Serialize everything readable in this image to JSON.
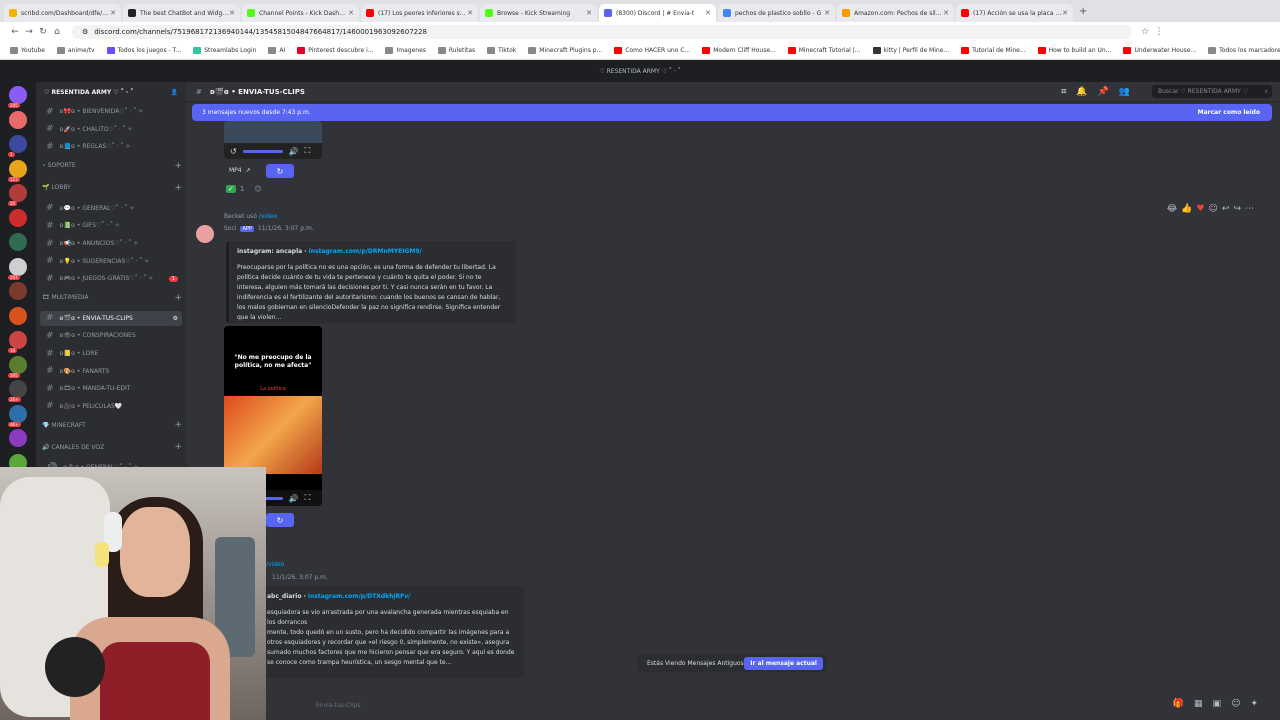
{
  "browser": {
    "tabs": [
      {
        "title": "scribd.com/Dashboard/dfe/actio",
        "color": "#f4b400",
        "active": false
      },
      {
        "title": "The best ChatBot and Widgets",
        "color": "#202124",
        "active": false
      },
      {
        "title": "Channel Points - Kick Dashboa",
        "color": "#53fc18",
        "active": false
      },
      {
        "title": "(17) Los peores inferiores sobre",
        "color": "#ff0000",
        "active": false
      },
      {
        "title": "Browse - Kick Streaming",
        "color": "#53fc18",
        "active": false
      },
      {
        "title": "(8300) Discord | # Envia-t",
        "color": "#5865f2",
        "active": true
      },
      {
        "title": "pechos de plastico sobllo - G",
        "color": "#4285f4",
        "active": false
      },
      {
        "title": "Amazon.com: Pechos de silico",
        "color": "#ff9900",
        "active": false
      },
      {
        "title": "(17) Acción se usa la placa de",
        "color": "#ff0000",
        "active": false
      }
    ],
    "url": "discord.com/channels/751968172136940144/1354581504847664817/1460001963092607228",
    "bookmarks": [
      {
        "label": "Youtube",
        "color": "#888"
      },
      {
        "label": "anime/tv",
        "color": "#888"
      },
      {
        "label": "Todos los juegos - T...",
        "color": "#6d4cff"
      },
      {
        "label": "Streamlabs Login",
        "color": "#31c3a2"
      },
      {
        "label": "AI",
        "color": "#888"
      },
      {
        "label": "Pinterest descubre i...",
        "color": "#e60023"
      },
      {
        "label": "Imagenes",
        "color": "#888"
      },
      {
        "label": "Ruletitas",
        "color": "#888"
      },
      {
        "label": "Tiktok",
        "color": "#888"
      },
      {
        "label": "Minecraft Plugins p...",
        "color": "#888"
      },
      {
        "label": "Como HACER uno C...",
        "color": "#ff0000"
      },
      {
        "label": "Modern Cliff House...",
        "color": "#ff0000"
      },
      {
        "label": "Minecraft Tutorial |...",
        "color": "#ff0000"
      },
      {
        "label": "kitty | Perfil de Mine...",
        "color": "#333"
      },
      {
        "label": "Tutorial de Mine...",
        "color": "#ff0000"
      },
      {
        "label": "How to build an Un...",
        "color": "#ff0000"
      },
      {
        "label": "Underwater House...",
        "color": "#ff0000"
      },
      {
        "label": "Todos los marcadores",
        "color": "#888"
      }
    ]
  },
  "discord": {
    "window_title": "♡ RESENTIDA ARMY ♡ ˚ · ˚",
    "server_name": "♡ RESENTIDA ARMY ♡ ˚ · ˚",
    "servers": [
      {
        "badge": "205",
        "color": "#8a5cf6"
      },
      {
        "badge": "",
        "color": "#e86a6a"
      },
      {
        "badge": "1",
        "color": "#3b4a9e"
      },
      {
        "badge": "123",
        "color": "#e8a41c"
      },
      {
        "badge": "20",
        "color": "#b23b3b"
      },
      {
        "badge": "",
        "color": "#cf2d2d"
      },
      {
        "badge": "",
        "color": "#2e6b4f"
      },
      {
        "badge": "247",
        "color": "#cfcfcf"
      },
      {
        "badge": "",
        "color": "#7a3b2e"
      },
      {
        "badge": "",
        "color": "#d9541c"
      },
      {
        "badge": "14",
        "color": "#c44"
      },
      {
        "badge": "395",
        "color": "#5b7d2e"
      },
      {
        "badge": "2K+",
        "color": "#444"
      },
      {
        "badge": "4K+",
        "color": "#2d6fa8"
      },
      {
        "badge": "",
        "color": "#8b3bbf"
      },
      {
        "badge": "609",
        "color": "#5aa83b"
      }
    ],
    "channel_list": [
      {
        "type": "channel",
        "label": "ʚ🎀ɞ • BIENVENIDA♡˚ · ˚ ✧",
        "selected": false
      },
      {
        "type": "channel",
        "label": "ʚ🚀ɞ • CHALITO♡˚ · ˚ ✧",
        "selected": false
      },
      {
        "type": "channel",
        "label": "ʚ📘ɞ • REGLAS♡˚ · ˚ ✧",
        "selected": false
      },
      {
        "type": "category",
        "label": "⋆ SOPORTE"
      },
      {
        "type": "category",
        "label": "🌱 LOBBY"
      },
      {
        "type": "channel",
        "label": "ʚ💬ɞ • GENERAL♡˚ · ˚ ✧",
        "selected": false
      },
      {
        "type": "channel",
        "label": "ʚ📗ɞ • GIFS♡˚ · ˚ ✧",
        "selected": false
      },
      {
        "type": "channel",
        "label": "ʚ📢ɞ • ANUNCIOS♡˚ · ˚ ✧",
        "selected": false
      },
      {
        "type": "channel",
        "label": "ʚ💡ɞ • SUGERENCIAS♡˚ · ˚ ✧",
        "selected": false
      },
      {
        "type": "channel",
        "label": "ʚ🎮ɞ • JUEGOS-GRATIS♡˚ · ˚ ✧",
        "selected": false,
        "badge": "1"
      },
      {
        "type": "category",
        "label": "🎞 MULTIMEDIA"
      },
      {
        "type": "channel",
        "label": "ʚ🎬ɞ • ENVIA-TUS-CLIPS",
        "selected": true
      },
      {
        "type": "channel",
        "label": "ʚ👁ɞ • CONSPIRACIONES",
        "selected": false
      },
      {
        "type": "channel",
        "label": "ʚ📒ɞ • LORE",
        "selected": false
      },
      {
        "type": "channel",
        "label": "ʚ🎨ɞ • FANARTS",
        "selected": false
      },
      {
        "type": "channel",
        "label": "ʚ🎞ɞ • MANDA-TU-EDIT",
        "selected": false
      },
      {
        "type": "channel",
        "label": "ʚ🎥ɞ • PELICULAS🤍",
        "selected": false
      },
      {
        "type": "category",
        "label": "💎 MINECRAFT"
      },
      {
        "type": "category",
        "label": "🔊 CANALES DE VOZ"
      },
      {
        "type": "voice",
        "label": "ʚ🎙ɞ • GENERAL♡˚ · ˚ ✧",
        "selected": false
      }
    ],
    "channel_title": "ʚ🎬ɞ • ENVIA-TUS-CLIPS",
    "search_placeholder": "Buscar ♡ RESENTIDA ARMY ♡",
    "new_messages": "3 mensajes nuevos desde 7:43 p.m.",
    "mark_read": "Marcar como leído",
    "msg1": {
      "mp4": "MP4",
      "reaction_count": "1"
    },
    "msg2": {
      "reply": "Becket usó",
      "reply_cmd": "/video",
      "author": "Soci",
      "app_tag": "APP",
      "time": "11/1/26, 3:07 p.m.",
      "embed_source": "instagram",
      "embed_user": "ancapla",
      "embed_link": "instagram.com/p/DRMnMYEIGM9/",
      "embed_text": "Preocuparse por la política no es una opción, es una forma de defender tu libertad. La política decide cuánto de tu vida te pertenece y cuánto te quita el poder. Si no te interesa, alguien más tomará las decisiones por ti. Y casi nunca serán en tu favor. La indiferencia es el fertilizante del autoritarismo: cuando los buenos se cansan de hablar, los malos gobiernan en silencioDefender la paz no significa rendirse. Significa entender que la violen...",
      "video_caption": "\"No me preocupo de la política, no me afecta\"",
      "video_sub": "La política"
    },
    "msg3": {
      "reply_cmd": "/video",
      "time": "11/1/26, 3:07 p.m.",
      "embed_user": "abc_diario",
      "embed_link": "instagram.com/p/DTXdkhjRFv/",
      "embed_text": "esquiadora se vio arrastrada por una avalancha generada mientras esquiaba en los dorrancos\nmente, todo quedó en un susto, pero ha decidido compartir las imágenes para a otros esquiadores y recordar que «el riesgo 0, simplemente, no existe», asegura sumado muchos factores que me hicieron pensar que era seguro. Y aquí es donde se conoce como trampa heurística, un sesgo mental que te..."
    },
    "older_messages": "Estás Viendo Mensajes Antiguos",
    "jump_current": "Ir al mensaje actual",
    "input_placeholder": "Envia-tus-Clips"
  }
}
